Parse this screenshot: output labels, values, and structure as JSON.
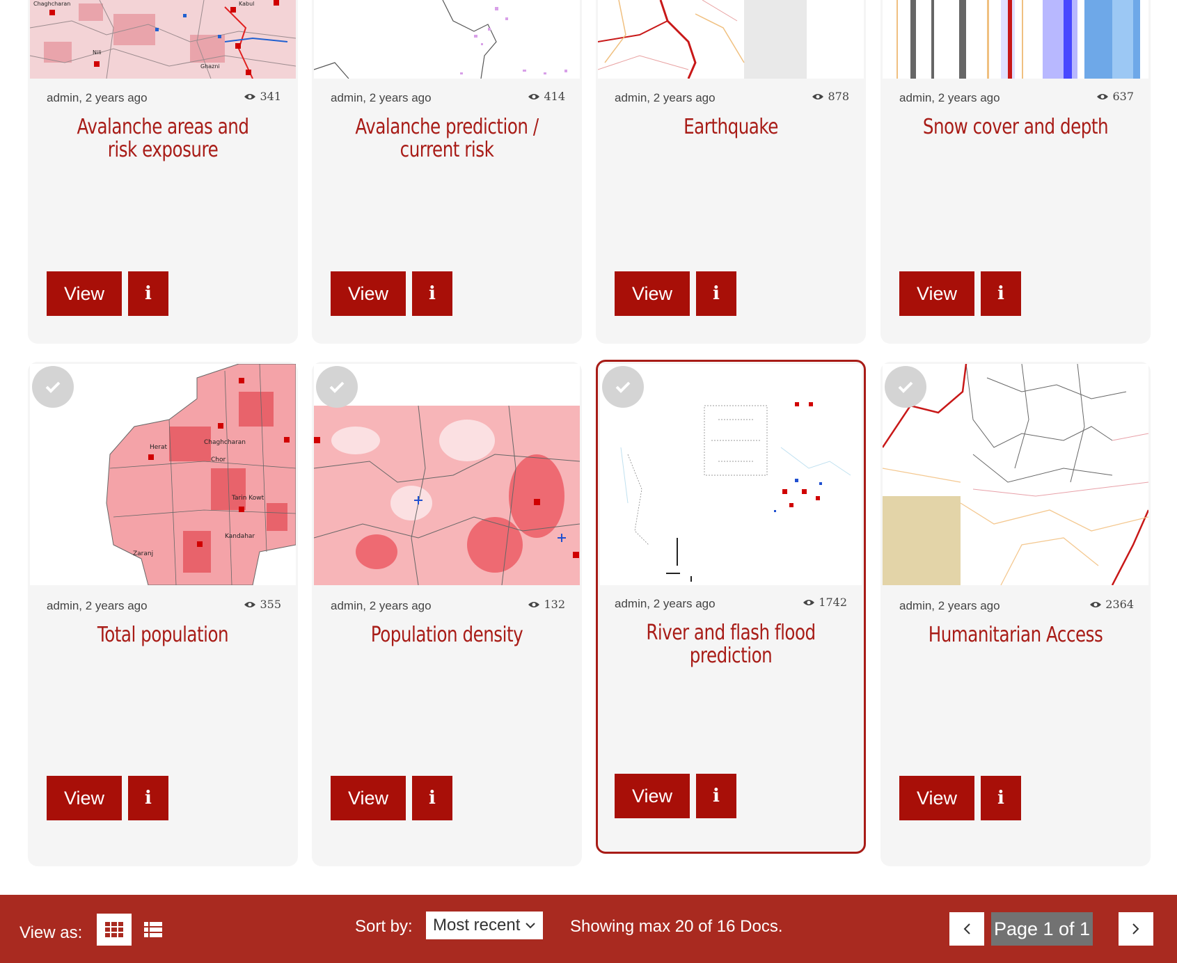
{
  "cards": [
    {
      "author": "admin, 2 years ago",
      "views": "341",
      "title": "Avalanche areas and risk exposure",
      "view_label": "View",
      "info_label": "i",
      "thumb": "map-avalanche-areas"
    },
    {
      "author": "admin, 2 years ago",
      "views": "414",
      "title": "Avalanche prediction / current risk",
      "view_label": "View",
      "info_label": "i",
      "thumb": "map-avalanche-prediction"
    },
    {
      "author": "admin, 2 years ago",
      "views": "878",
      "title": "Earthquake",
      "view_label": "View",
      "info_label": "i",
      "thumb": "map-earthquake"
    },
    {
      "author": "admin, 2 years ago",
      "views": "637",
      "title": "Snow cover and depth",
      "view_label": "View",
      "info_label": "i",
      "thumb": "map-snow-cover"
    },
    {
      "author": "admin, 2 years ago",
      "views": "355",
      "title": "Total population",
      "view_label": "View",
      "info_label": "i",
      "thumb": "map-total-population"
    },
    {
      "author": "admin, 2 years ago",
      "views": "132",
      "title": "Population density",
      "view_label": "View",
      "info_label": "i",
      "thumb": "map-population-density"
    },
    {
      "author": "admin, 2 years ago",
      "views": "1742",
      "title": "River and flash flood prediction",
      "view_label": "View",
      "info_label": "i",
      "thumb": "map-flood",
      "selected": true
    },
    {
      "author": "admin, 2 years ago",
      "views": "2364",
      "title": "Humanitarian Access",
      "view_label": "View",
      "info_label": "i",
      "thumb": "map-humanitarian"
    }
  ],
  "footer": {
    "view_as_label": "View as:",
    "sort_label": "Sort by:",
    "sort_value": "Most recent",
    "showing_text": "Showing max 20 of 16  Docs.",
    "page_label": "Page 1 of 1"
  },
  "colors": {
    "accent": "#a80f08",
    "footer_bg": "#a92a20",
    "title": "#a81c17",
    "card_bg": "#f5f5f5"
  }
}
